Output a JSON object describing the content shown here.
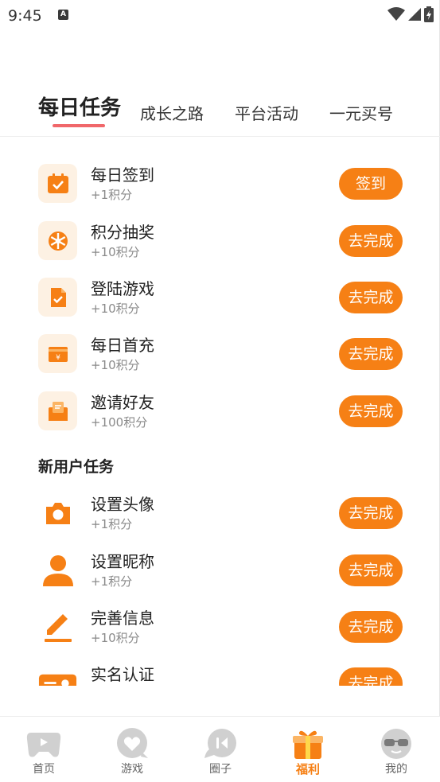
{
  "status_bar": {
    "time": "9:45",
    "notification_glyph": "A"
  },
  "tabs": [
    {
      "label": "每日任务",
      "active": true
    },
    {
      "label": "成长之路",
      "active": false
    },
    {
      "label": "平台活动",
      "active": false
    },
    {
      "label": "一元买号",
      "active": false
    }
  ],
  "daily_tasks": [
    {
      "name": "每日签到",
      "points": "+1积分",
      "button": "签到",
      "icon": "calendar-check-icon"
    },
    {
      "name": "积分抽奖",
      "points": "+10积分",
      "button": "去完成",
      "icon": "lottery-wheel-icon"
    },
    {
      "name": "登陆游戏",
      "points": "+10积分",
      "button": "去完成",
      "icon": "document-check-icon"
    },
    {
      "name": "每日首充",
      "points": "+10积分",
      "button": "去完成",
      "icon": "yuan-card-icon"
    },
    {
      "name": "邀请好友",
      "points": "+100积分",
      "button": "去完成",
      "icon": "envelope-icon"
    }
  ],
  "new_user_section": {
    "title": "新用户任务"
  },
  "new_user_tasks": [
    {
      "name": "设置头像",
      "points": "+1积分",
      "button": "去完成",
      "icon": "camera-icon"
    },
    {
      "name": "设置昵称",
      "points": "+1积分",
      "button": "去完成",
      "icon": "person-icon"
    },
    {
      "name": "完善信息",
      "points": "+10积分",
      "button": "去完成",
      "icon": "pencil-icon"
    },
    {
      "name": "实名认证",
      "points": "",
      "button": "去完成",
      "icon": "id-card-icon"
    }
  ],
  "bottom_nav": [
    {
      "label": "首页",
      "icon": "gamepad-icon",
      "active": false
    },
    {
      "label": "游戏",
      "icon": "game-heart-icon",
      "active": false
    },
    {
      "label": "圈子",
      "icon": "chat-bubble-icon",
      "active": false
    },
    {
      "label": "福利",
      "icon": "gift-icon",
      "active": true
    },
    {
      "label": "我的",
      "icon": "sunglasses-face-icon",
      "active": false
    }
  ],
  "colors": {
    "accent": "#f68015",
    "tab_underline": "#f0676a",
    "icon_bg": "#fdf1e3",
    "nav_inactive": "#d0d0d0"
  }
}
